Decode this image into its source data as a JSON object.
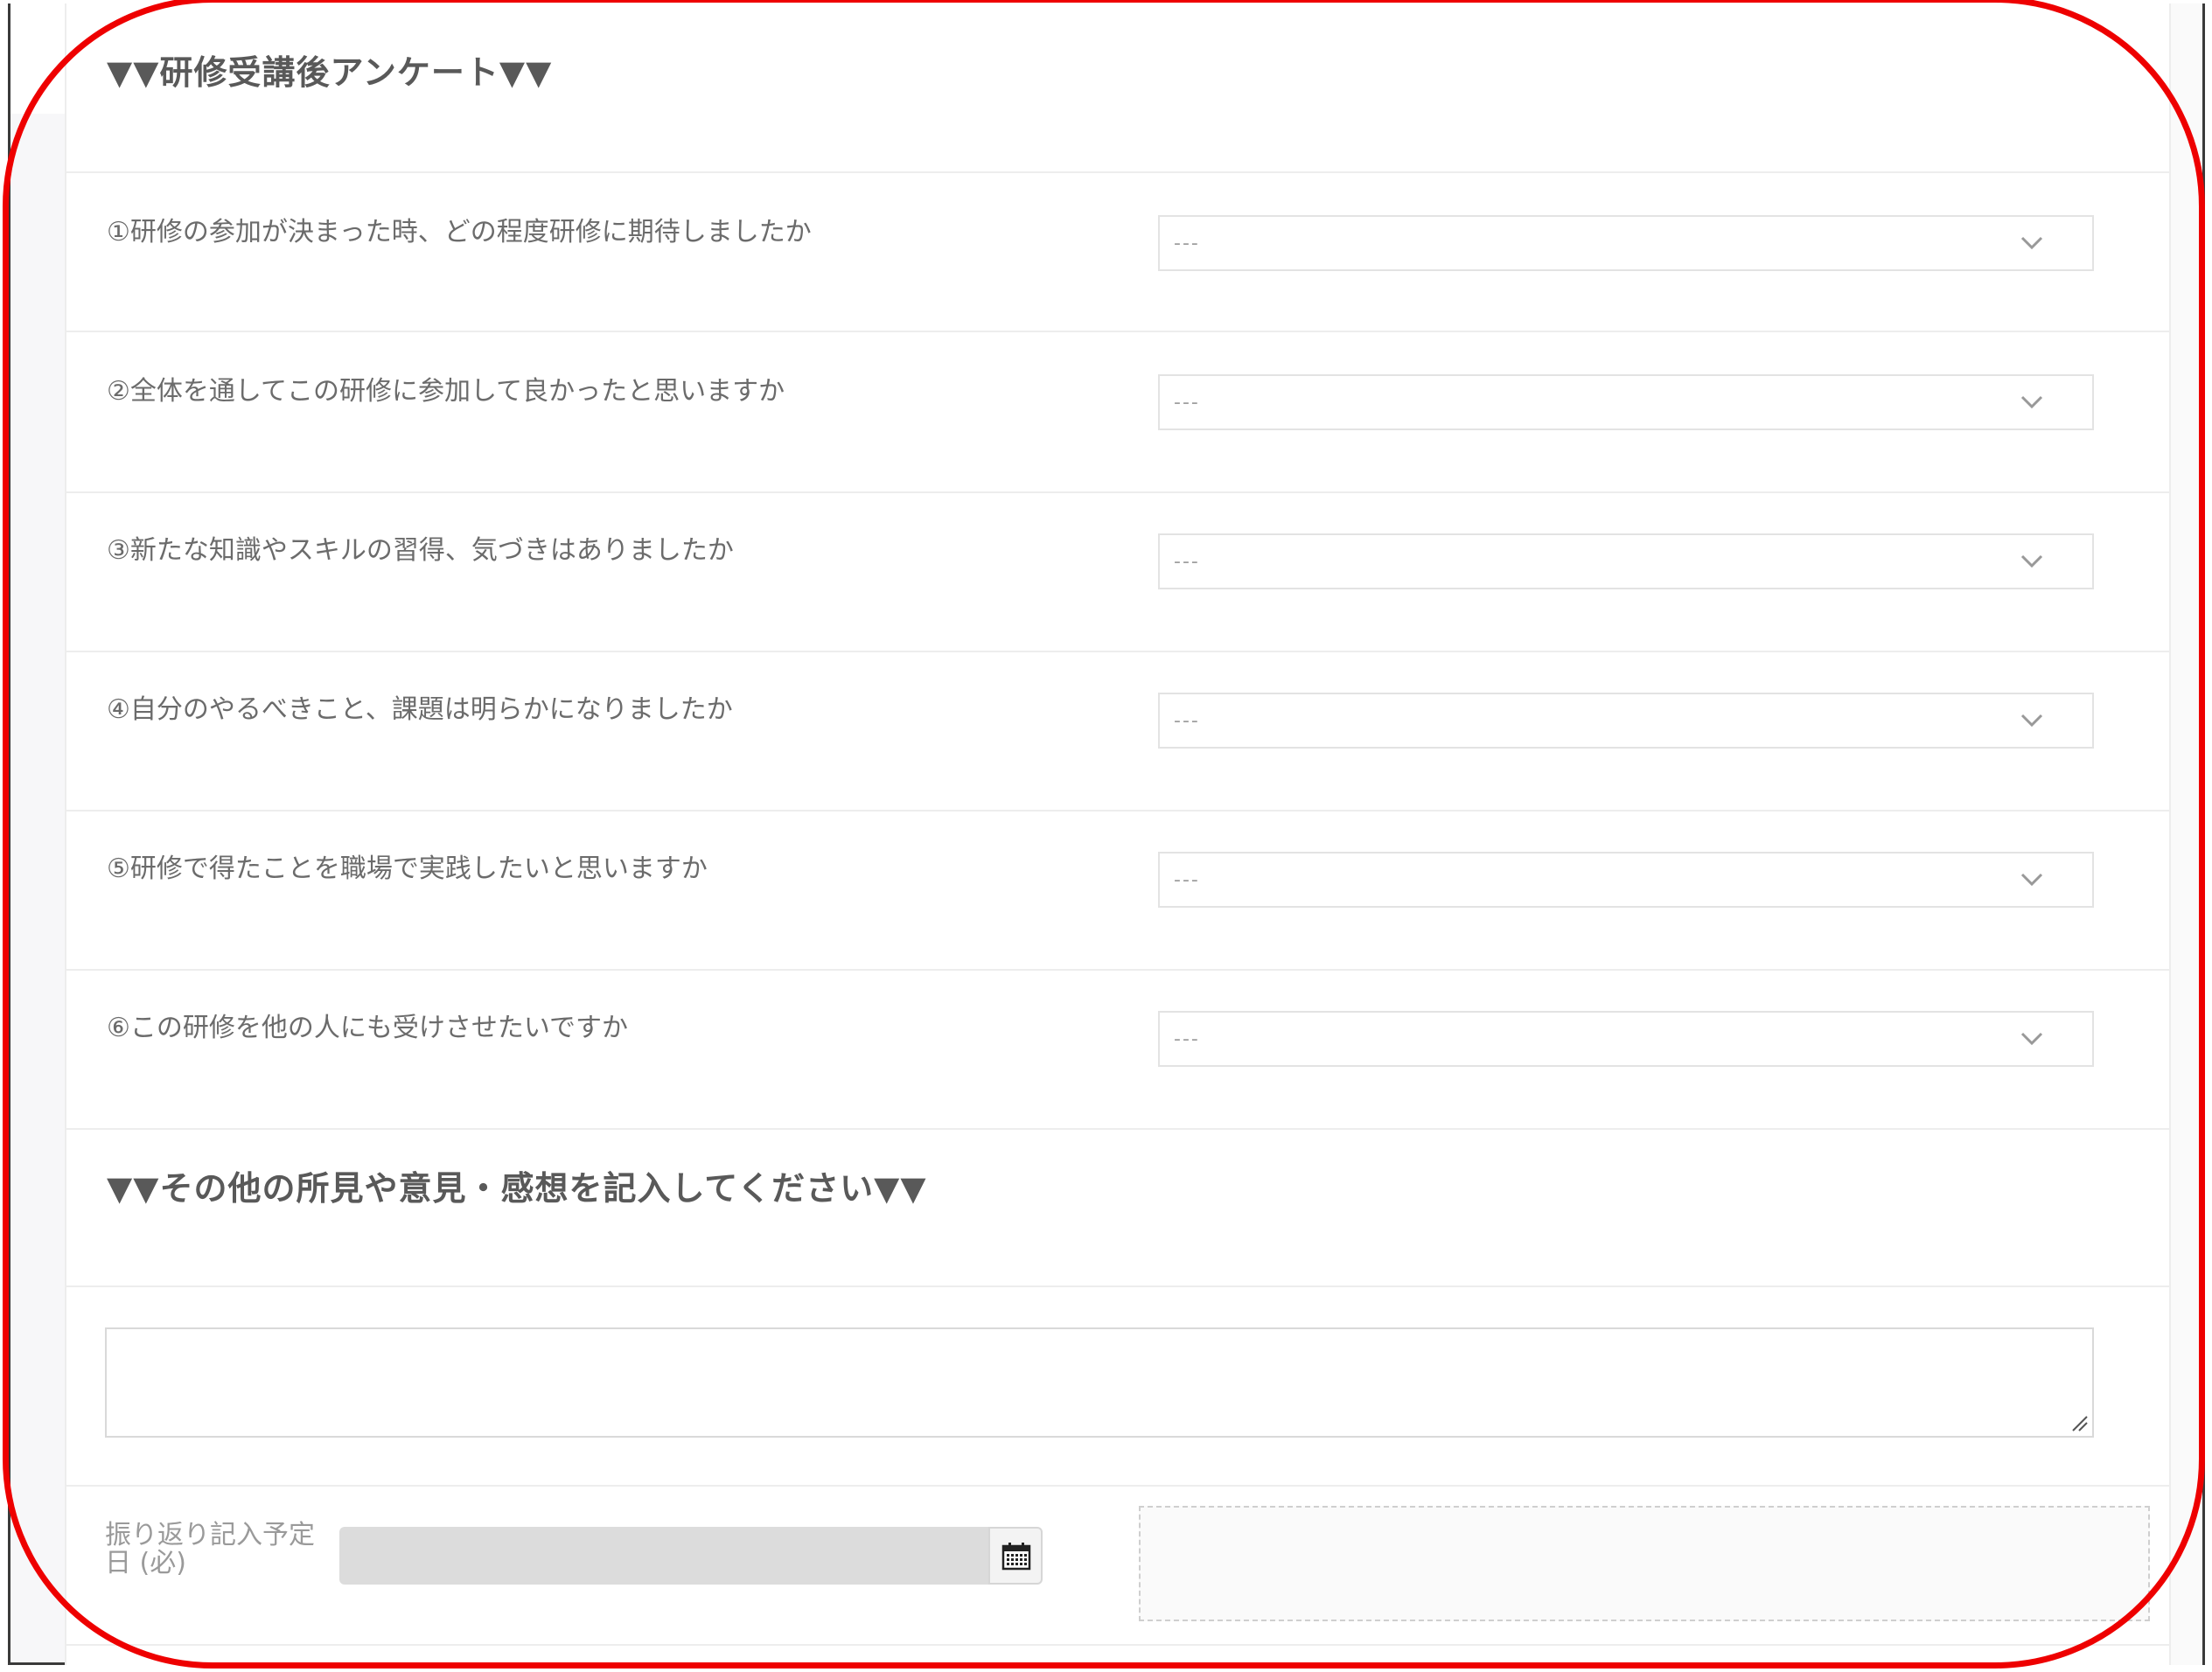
{
  "survey": {
    "title": "▼▼研修受講後アンケート▼▼",
    "questions": [
      {
        "label": "①研修の参加が決まった時、どの程度研修に期待しましたか",
        "value": "---"
      },
      {
        "label": "②全体を通してこの研修に参加して良かったと思いますか",
        "value": "---"
      },
      {
        "label": "③新たな知識やスキルの習得、気づきはありましたか",
        "value": "---"
      },
      {
        "label": "④自分のやるべきこと、課題は明らかになりましたか",
        "value": "---"
      },
      {
        "label": "⑤研修で得たことを職場で実践したいと思いますか",
        "value": "---"
      },
      {
        "label": "⑥この研修を他の人にも受けさせたいですか",
        "value": "---"
      }
    ]
  },
  "comments": {
    "title": "▼▼その他の所見や意見・感想を記入してください▼▼",
    "value": ""
  },
  "reflection_date": {
    "label": "振り返り記入予定日 (必)",
    "value": ""
  },
  "colors": {
    "highlight": "#ee0000",
    "input_disabled": "#dcdcdc"
  }
}
